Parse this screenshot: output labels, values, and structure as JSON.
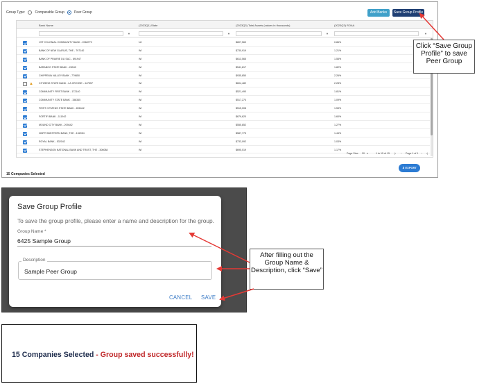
{
  "toolbar": {
    "group_type_label": "Group Type:",
    "radio_comparable": "Comparable Group",
    "radio_peer": "Peer Group",
    "add_banks": "Add Banks",
    "save_group_profile": "Save Group Profile"
  },
  "grid": {
    "columns": [
      "Bank Name",
      "(2023Q1) State",
      "(2023Q3) Total Assets (values in thousands)",
      "(2023Q3) ROAA"
    ],
    "rows": [
      {
        "bank": "1ST COLONIAL COMMUNITY BANK - 2068779",
        "state": "NJ",
        "assets": "$807,569",
        "roaa": "0.86%",
        "checked": true,
        "warning": false
      },
      {
        "bank": "BANK OF NEW GLARUS, THE - 797140",
        "state": "WI",
        "assets": "$730,919",
        "roaa": "1.21%",
        "checked": true,
        "warning": false
      },
      {
        "bank": "BANK OF PRAIRIE DU SAC - 891947",
        "state": "WI",
        "assets": "$613,565",
        "roaa": "1.55%",
        "checked": true,
        "warning": false
      },
      {
        "bank": "BARABOO STATE BANK - 28949",
        "state": "WI",
        "assets": "$541,817",
        "roaa": "1.82%",
        "checked": true,
        "warning": false
      },
      {
        "bank": "CHIPPEWA VALLEY BANK - 779650",
        "state": "WI",
        "assets": "$935,850",
        "roaa": "2.26%",
        "checked": true,
        "warning": false
      },
      {
        "bank": "CITIZENS STATE BANK - LA CROSSE - 447557",
        "state": "WI",
        "assets": "$604,482",
        "roaa": "2.28%",
        "checked": false,
        "warning": true
      },
      {
        "bank": "COMMUNITY FIRST BANK - 172140",
        "state": "WI",
        "assets": "$521,490",
        "roaa": "1.81%",
        "checked": true,
        "warning": false
      },
      {
        "bank": "COMMUNITY STATE BANK - 158345",
        "state": "WI",
        "assets": "$517,274",
        "roaa": "1.09%",
        "checked": true,
        "warning": false
      },
      {
        "bank": "FIRST CITIZENS STATE BANK - 891642",
        "state": "WI",
        "assets": "$515,008",
        "roaa": "1.53%",
        "checked": true,
        "warning": false
      },
      {
        "bank": "FORTIFI BANK - 111942",
        "state": "WI",
        "assets": "$679,620",
        "roaa": "1.60%",
        "checked": true,
        "warning": false
      },
      {
        "bank": "MOUND CITY BANK - 209442",
        "state": "WI",
        "assets": "$555,852",
        "roaa": "1.27%",
        "checked": true,
        "warning": false
      },
      {
        "bank": "NORTHWESTERN BANK, THE - 152054",
        "state": "WI",
        "assets": "$587,775",
        "roaa": "1.44%",
        "checked": true,
        "warning": false
      },
      {
        "bank": "ROYAL BANK - 532042",
        "state": "WI",
        "assets": "$733,092",
        "roaa": "1.03%",
        "checked": true,
        "warning": false
      },
      {
        "bank": "STEPHENSON NATIONAL BANK AND TRUST, THE - 306088",
        "state": "WI",
        "assets": "$695,019",
        "roaa": "1.17%",
        "checked": true,
        "warning": false
      }
    ],
    "pager": {
      "page_size_label": "Page Size:",
      "page_size": "20",
      "range": "1 to 15 of 15",
      "page": "Page 1 of 1"
    },
    "companies_selected": "15 Companies Selected",
    "export": "EXPORT"
  },
  "callouts": {
    "save_hint": "Click “Save Group Profile” to save Peer Group",
    "fill_hint": "After filling out the Group Name & Description, click “Save”"
  },
  "dialog": {
    "title": "Save Group Profile",
    "description": "To save the group profile, please enter a name and description for the group.",
    "group_name_label": "Group Name *",
    "group_name_value": "6425 Sample Group",
    "description_label": "Description",
    "description_value": "Sample Peer Group",
    "cancel": "CANCEL",
    "save": "SAVE"
  },
  "result": {
    "count": "15 Companies Selected",
    "separator": " - ",
    "message": "Group saved successfully!"
  },
  "colors": {
    "primary_button": "#1f3f73",
    "secondary_button": "#3fa0c9",
    "success_text": "#c0282a",
    "arrow": "#e53935"
  }
}
